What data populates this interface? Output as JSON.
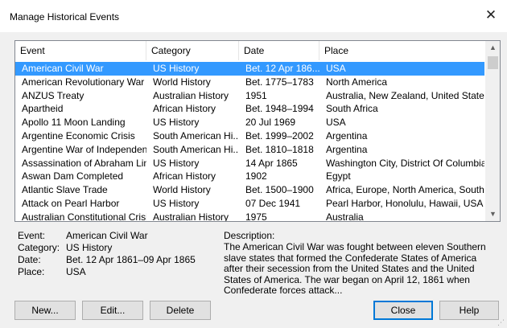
{
  "window": {
    "title": "Manage Historical Events",
    "close_glyph": "✕"
  },
  "columns": [
    "Event",
    "Category",
    "Date",
    "Place"
  ],
  "rows": [
    {
      "event": "American Civil War",
      "category": "US History",
      "date": "Bet. 12 Apr 186...",
      "place": "USA",
      "selected": true
    },
    {
      "event": "American Revolutionary War",
      "category": "World History",
      "date": "Bet. 1775–1783",
      "place": "North America"
    },
    {
      "event": "ANZUS Treaty",
      "category": "Australian History",
      "date": "1951",
      "place": "Australia, New Zealand, United States"
    },
    {
      "event": "Apartheid",
      "category": "African History",
      "date": "Bet. 1948–1994",
      "place": "South Africa"
    },
    {
      "event": "Apollo 11 Moon Landing",
      "category": "US History",
      "date": "20 Jul 1969",
      "place": "USA"
    },
    {
      "event": "Argentine Economic Crisis",
      "category": "South American Hi...",
      "date": "Bet. 1999–2002",
      "place": "Argentina"
    },
    {
      "event": "Argentine War of Independen...",
      "category": "South American Hi...",
      "date": "Bet. 1810–1818",
      "place": "Argentina"
    },
    {
      "event": "Assassination of Abraham Lin...",
      "category": "US History",
      "date": "14 Apr 1865",
      "place": "Washington City, District Of Columbia..."
    },
    {
      "event": "Aswan Dam Completed",
      "category": "African History",
      "date": "1902",
      "place": "Egypt"
    },
    {
      "event": "Atlantic Slave Trade",
      "category": "World History",
      "date": "Bet. 1500–1900",
      "place": "Africa, Europe, North America, South ..."
    },
    {
      "event": "Attack on Pearl Harbor",
      "category": "US History",
      "date": "07 Dec 1941",
      "place": "Pearl Harbor, Honolulu, Hawaii, USA"
    },
    {
      "event": "Australian Constitutional Crisis",
      "category": "Australian History",
      "date": "1975",
      "place": "Australia"
    }
  ],
  "details": {
    "event_label": "Event:",
    "event_value": "American Civil War",
    "category_label": "Category:",
    "category_value": "US History",
    "date_label": "Date:",
    "date_value": "Bet. 12 Apr 1861–09 Apr 1865",
    "place_label": "Place:",
    "place_value": "USA"
  },
  "description": {
    "label": "Description:",
    "text": "The American Civil War was fought between eleven Southern slave states that formed the Confederate States of America after their secession from the United States and the United States of America. The war began on April 12, 1861 when Confederate forces attack..."
  },
  "buttons": {
    "new": "New...",
    "edit": "Edit...",
    "delete": "Delete",
    "close": "Close",
    "help": "Help"
  },
  "colors": {
    "selection": "#3399ff",
    "default_button_border": "#0078d7",
    "dialog_bg": "#f0f0f0"
  },
  "icons": {
    "scroll_up": "chevron-up-icon",
    "scroll_down": "chevron-down-icon",
    "resize": "size-grip-icon"
  }
}
